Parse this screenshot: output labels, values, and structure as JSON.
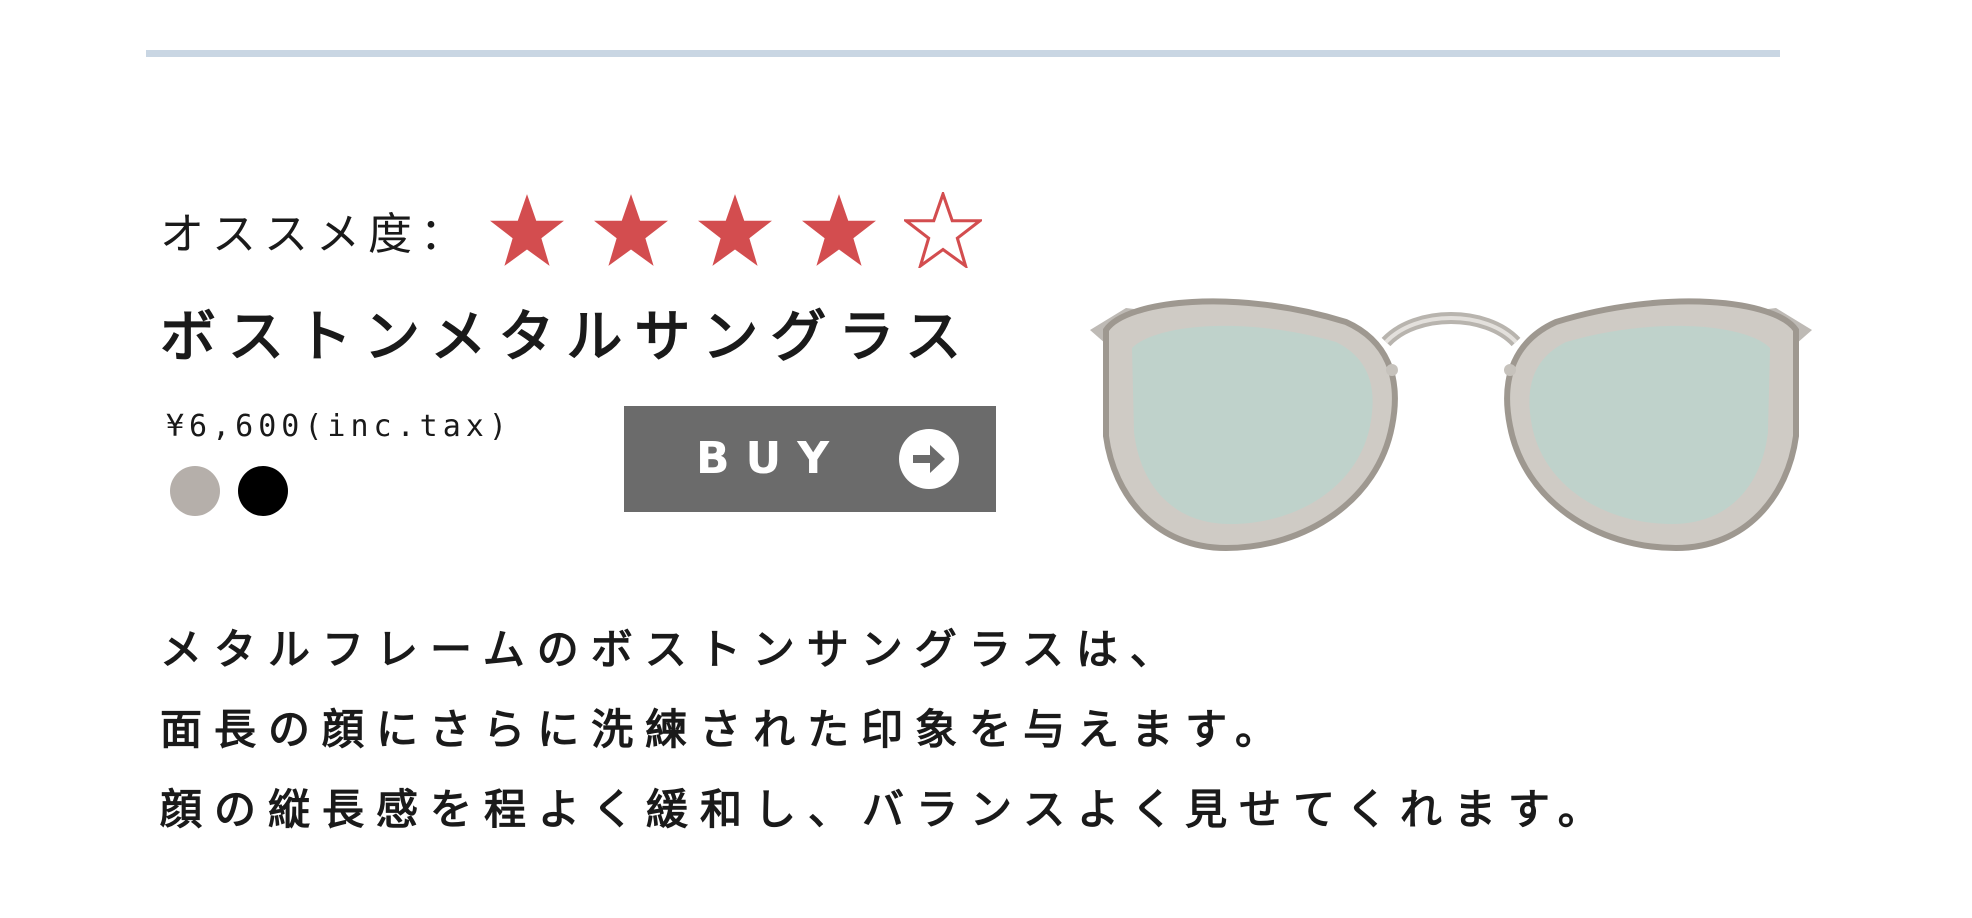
{
  "rating": {
    "label": "オススメ度：",
    "score": 4,
    "max": 5,
    "filled_color": "#d34d4f",
    "empty_color": "#d34d4f"
  },
  "product": {
    "name": "ボストンメタルサングラス",
    "price": "¥6,600(inc.tax)",
    "colors": [
      "#b5afaa",
      "#000000"
    ],
    "image_icon": "boston-sunglasses-image"
  },
  "buy_button": {
    "label": "BUY",
    "icon": "arrow-right-circle-icon",
    "background": "#6b6b6b"
  },
  "description": {
    "lines": [
      "メタルフレームのボストンサングラスは、",
      "面長の顔にさらに洗練された印象を与えます。",
      "顔の縦長感を程よく緩和し、バランスよく見せてくれます。"
    ]
  },
  "accent": {
    "rule_color": "#c9d6e3"
  }
}
